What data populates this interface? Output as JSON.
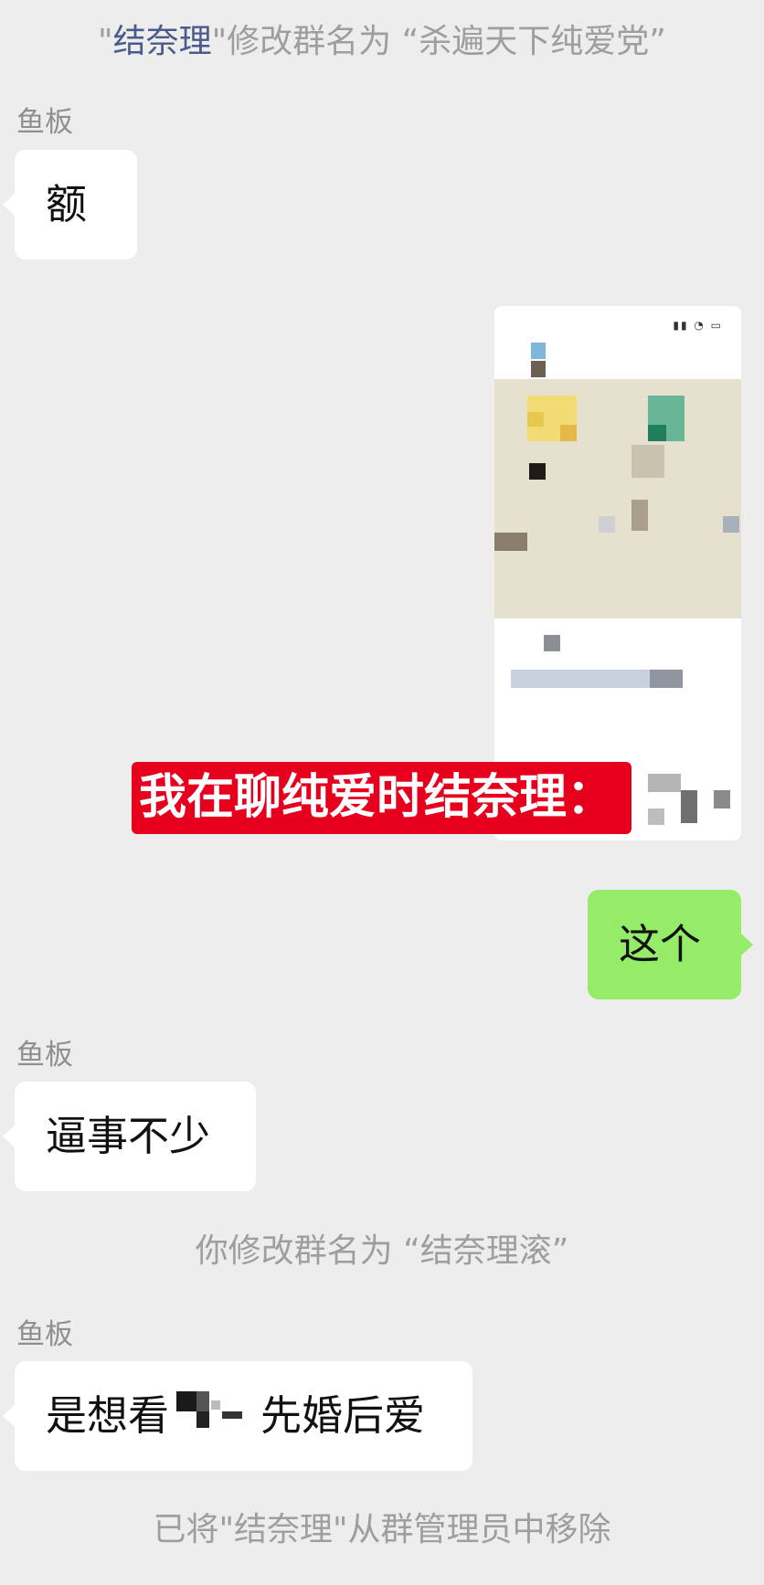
{
  "system_messages": {
    "rename_1": {
      "quote_open": "\"",
      "actor": "结奈理",
      "text": "\"修改群名为 “杀遍天下纯爱党”"
    },
    "rename_2": "你修改群名为 “结奈理滚”",
    "admin_removed": "已将\"结奈理\"从群管理员中移除"
  },
  "messages": [
    {
      "sender": "鱼板",
      "text": "额"
    },
    {
      "self": true,
      "image_caption": "我在聊纯爱时结奈理："
    },
    {
      "self": true,
      "text": "这个"
    },
    {
      "sender": "鱼板",
      "text": "逼事不少"
    },
    {
      "sender": "鱼板",
      "text_part1": "是想看",
      "text_part2": "先婚后爱"
    }
  ],
  "colors": {
    "background": "#ededed",
    "bubble_incoming": "#ffffff",
    "bubble_outgoing": "#95ec69",
    "caption_bg": "#e6001e",
    "system_text": "#9e9e9e",
    "link_text": "#4a5a8a"
  }
}
